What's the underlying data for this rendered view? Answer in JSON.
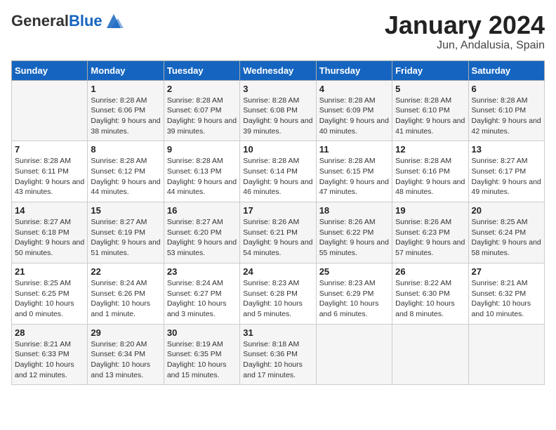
{
  "header": {
    "logo_general": "General",
    "logo_blue": "Blue",
    "main_title": "January 2024",
    "sub_title": "Jun, Andalusia, Spain"
  },
  "days_of_week": [
    "Sunday",
    "Monday",
    "Tuesday",
    "Wednesday",
    "Thursday",
    "Friday",
    "Saturday"
  ],
  "weeks": [
    [
      {
        "day": "",
        "sunrise": "",
        "sunset": "",
        "daylight": ""
      },
      {
        "day": "1",
        "sunrise": "Sunrise: 8:28 AM",
        "sunset": "Sunset: 6:06 PM",
        "daylight": "Daylight: 9 hours and 38 minutes."
      },
      {
        "day": "2",
        "sunrise": "Sunrise: 8:28 AM",
        "sunset": "Sunset: 6:07 PM",
        "daylight": "Daylight: 9 hours and 39 minutes."
      },
      {
        "day": "3",
        "sunrise": "Sunrise: 8:28 AM",
        "sunset": "Sunset: 6:08 PM",
        "daylight": "Daylight: 9 hours and 39 minutes."
      },
      {
        "day": "4",
        "sunrise": "Sunrise: 8:28 AM",
        "sunset": "Sunset: 6:09 PM",
        "daylight": "Daylight: 9 hours and 40 minutes."
      },
      {
        "day": "5",
        "sunrise": "Sunrise: 8:28 AM",
        "sunset": "Sunset: 6:10 PM",
        "daylight": "Daylight: 9 hours and 41 minutes."
      },
      {
        "day": "6",
        "sunrise": "Sunrise: 8:28 AM",
        "sunset": "Sunset: 6:10 PM",
        "daylight": "Daylight: 9 hours and 42 minutes."
      }
    ],
    [
      {
        "day": "7",
        "sunrise": "Sunrise: 8:28 AM",
        "sunset": "Sunset: 6:11 PM",
        "daylight": "Daylight: 9 hours and 43 minutes."
      },
      {
        "day": "8",
        "sunrise": "Sunrise: 8:28 AM",
        "sunset": "Sunset: 6:12 PM",
        "daylight": "Daylight: 9 hours and 44 minutes."
      },
      {
        "day": "9",
        "sunrise": "Sunrise: 8:28 AM",
        "sunset": "Sunset: 6:13 PM",
        "daylight": "Daylight: 9 hours and 44 minutes."
      },
      {
        "day": "10",
        "sunrise": "Sunrise: 8:28 AM",
        "sunset": "Sunset: 6:14 PM",
        "daylight": "Daylight: 9 hours and 46 minutes."
      },
      {
        "day": "11",
        "sunrise": "Sunrise: 8:28 AM",
        "sunset": "Sunset: 6:15 PM",
        "daylight": "Daylight: 9 hours and 47 minutes."
      },
      {
        "day": "12",
        "sunrise": "Sunrise: 8:28 AM",
        "sunset": "Sunset: 6:16 PM",
        "daylight": "Daylight: 9 hours and 48 minutes."
      },
      {
        "day": "13",
        "sunrise": "Sunrise: 8:27 AM",
        "sunset": "Sunset: 6:17 PM",
        "daylight": "Daylight: 9 hours and 49 minutes."
      }
    ],
    [
      {
        "day": "14",
        "sunrise": "Sunrise: 8:27 AM",
        "sunset": "Sunset: 6:18 PM",
        "daylight": "Daylight: 9 hours and 50 minutes."
      },
      {
        "day": "15",
        "sunrise": "Sunrise: 8:27 AM",
        "sunset": "Sunset: 6:19 PM",
        "daylight": "Daylight: 9 hours and 51 minutes."
      },
      {
        "day": "16",
        "sunrise": "Sunrise: 8:27 AM",
        "sunset": "Sunset: 6:20 PM",
        "daylight": "Daylight: 9 hours and 53 minutes."
      },
      {
        "day": "17",
        "sunrise": "Sunrise: 8:26 AM",
        "sunset": "Sunset: 6:21 PM",
        "daylight": "Daylight: 9 hours and 54 minutes."
      },
      {
        "day": "18",
        "sunrise": "Sunrise: 8:26 AM",
        "sunset": "Sunset: 6:22 PM",
        "daylight": "Daylight: 9 hours and 55 minutes."
      },
      {
        "day": "19",
        "sunrise": "Sunrise: 8:26 AM",
        "sunset": "Sunset: 6:23 PM",
        "daylight": "Daylight: 9 hours and 57 minutes."
      },
      {
        "day": "20",
        "sunrise": "Sunrise: 8:25 AM",
        "sunset": "Sunset: 6:24 PM",
        "daylight": "Daylight: 9 hours and 58 minutes."
      }
    ],
    [
      {
        "day": "21",
        "sunrise": "Sunrise: 8:25 AM",
        "sunset": "Sunset: 6:25 PM",
        "daylight": "Daylight: 10 hours and 0 minutes."
      },
      {
        "day": "22",
        "sunrise": "Sunrise: 8:24 AM",
        "sunset": "Sunset: 6:26 PM",
        "daylight": "Daylight: 10 hours and 1 minute."
      },
      {
        "day": "23",
        "sunrise": "Sunrise: 8:24 AM",
        "sunset": "Sunset: 6:27 PM",
        "daylight": "Daylight: 10 hours and 3 minutes."
      },
      {
        "day": "24",
        "sunrise": "Sunrise: 8:23 AM",
        "sunset": "Sunset: 6:28 PM",
        "daylight": "Daylight: 10 hours and 5 minutes."
      },
      {
        "day": "25",
        "sunrise": "Sunrise: 8:23 AM",
        "sunset": "Sunset: 6:29 PM",
        "daylight": "Daylight: 10 hours and 6 minutes."
      },
      {
        "day": "26",
        "sunrise": "Sunrise: 8:22 AM",
        "sunset": "Sunset: 6:30 PM",
        "daylight": "Daylight: 10 hours and 8 minutes."
      },
      {
        "day": "27",
        "sunrise": "Sunrise: 8:21 AM",
        "sunset": "Sunset: 6:32 PM",
        "daylight": "Daylight: 10 hours and 10 minutes."
      }
    ],
    [
      {
        "day": "28",
        "sunrise": "Sunrise: 8:21 AM",
        "sunset": "Sunset: 6:33 PM",
        "daylight": "Daylight: 10 hours and 12 minutes."
      },
      {
        "day": "29",
        "sunrise": "Sunrise: 8:20 AM",
        "sunset": "Sunset: 6:34 PM",
        "daylight": "Daylight: 10 hours and 13 minutes."
      },
      {
        "day": "30",
        "sunrise": "Sunrise: 8:19 AM",
        "sunset": "Sunset: 6:35 PM",
        "daylight": "Daylight: 10 hours and 15 minutes."
      },
      {
        "day": "31",
        "sunrise": "Sunrise: 8:18 AM",
        "sunset": "Sunset: 6:36 PM",
        "daylight": "Daylight: 10 hours and 17 minutes."
      },
      {
        "day": "",
        "sunrise": "",
        "sunset": "",
        "daylight": ""
      },
      {
        "day": "",
        "sunrise": "",
        "sunset": "",
        "daylight": ""
      },
      {
        "day": "",
        "sunrise": "",
        "sunset": "",
        "daylight": ""
      }
    ]
  ]
}
